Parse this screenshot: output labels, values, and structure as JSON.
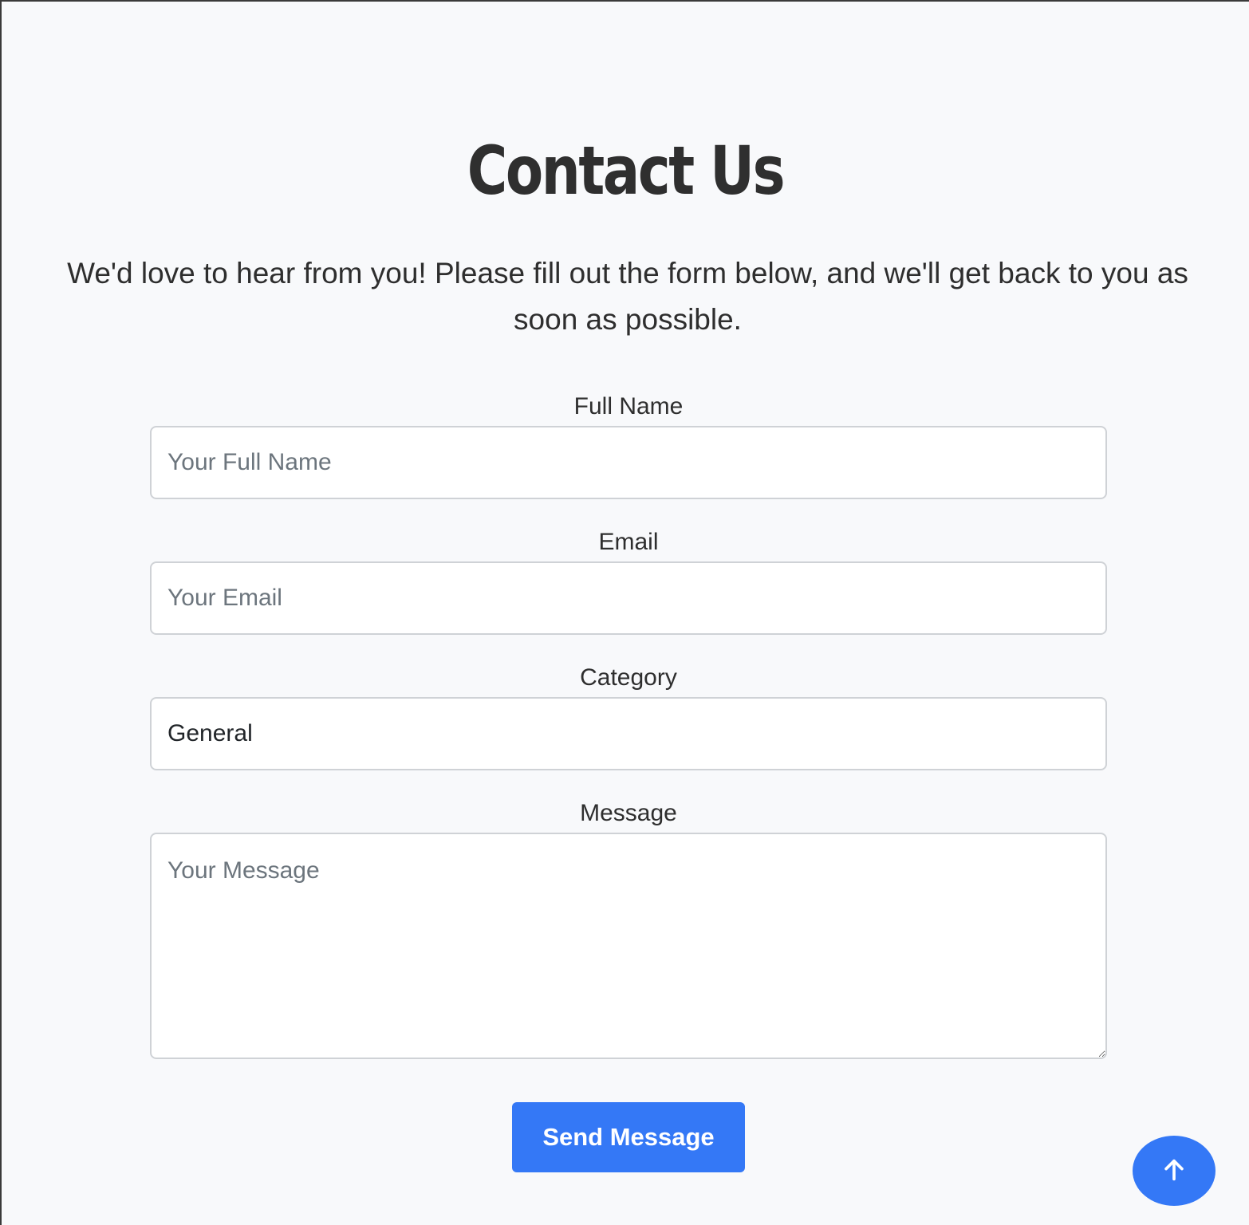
{
  "header": {
    "title": "Contact Us",
    "intro": "We'd love to hear from you! Please fill out the form below, and we'll get back to you as soon as possible."
  },
  "form": {
    "full_name": {
      "label": "Full Name",
      "placeholder": "Your Full Name",
      "value": ""
    },
    "email": {
      "label": "Email",
      "placeholder": "Your Email",
      "value": ""
    },
    "category": {
      "label": "Category",
      "selected": "General"
    },
    "message": {
      "label": "Message",
      "placeholder": "Your Message",
      "value": ""
    },
    "submit_label": "Send Message"
  },
  "scroll_top": {
    "icon": "arrow-up-icon"
  },
  "colors": {
    "accent": "#3478f6",
    "background": "#f8f9fb",
    "field_border": "#cfd2d6",
    "text": "#2e2e2e",
    "placeholder": "#6c757d"
  }
}
